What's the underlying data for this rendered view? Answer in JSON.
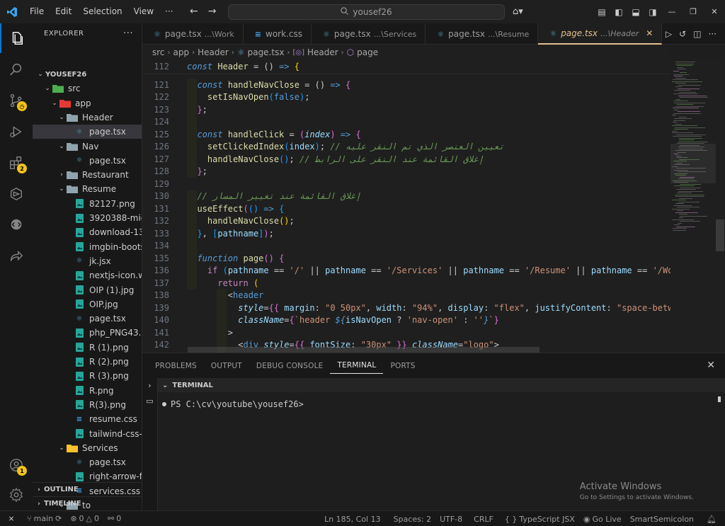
{
  "titlebar": {
    "menu": [
      "File",
      "Edit",
      "Selection",
      "View",
      "···"
    ],
    "search_text": "yousef26"
  },
  "activity_badges": {
    "extensions": "2",
    "accounts": "1"
  },
  "sidebar": {
    "title": "EXPLORER",
    "more": "···",
    "tree": [
      {
        "label": "YOUSEF26",
        "depth": 0,
        "kind": "root",
        "chev": "⌄"
      },
      {
        "label": "src",
        "depth": 1,
        "kind": "folder-src",
        "chev": "⌄"
      },
      {
        "label": "app",
        "depth": 2,
        "kind": "folder-app",
        "chev": "⌄"
      },
      {
        "label": "Header",
        "depth": 3,
        "kind": "folder",
        "chev": "⌄"
      },
      {
        "label": "page.tsx",
        "depth": 4,
        "kind": "tsx",
        "selected": true
      },
      {
        "label": "Nav",
        "depth": 3,
        "kind": "folder",
        "chev": "⌄"
      },
      {
        "label": "page.tsx",
        "depth": 4,
        "kind": "tsx"
      },
      {
        "label": "Restaurant",
        "depth": 3,
        "kind": "folder",
        "chev": "›"
      },
      {
        "label": "Resume",
        "depth": 3,
        "kind": "folder",
        "chev": "⌄"
      },
      {
        "label": "82127.png",
        "depth": 4,
        "kind": "img"
      },
      {
        "label": "3920388-mid...",
        "depth": 4,
        "kind": "img"
      },
      {
        "label": "download-13....",
        "depth": 4,
        "kind": "img"
      },
      {
        "label": "imgbin-boots...",
        "depth": 4,
        "kind": "img"
      },
      {
        "label": "jk.jsx",
        "depth": 4,
        "kind": "tsx"
      },
      {
        "label": "nextjs-icon.w...",
        "depth": 4,
        "kind": "img"
      },
      {
        "label": "OIP (1).jpg",
        "depth": 4,
        "kind": "img"
      },
      {
        "label": "OIP.jpg",
        "depth": 4,
        "kind": "img"
      },
      {
        "label": "page.tsx",
        "depth": 4,
        "kind": "tsx"
      },
      {
        "label": "php_PNG43.p...",
        "depth": 4,
        "kind": "img"
      },
      {
        "label": "R (1).png",
        "depth": 4,
        "kind": "img"
      },
      {
        "label": "R (2).png",
        "depth": 4,
        "kind": "img"
      },
      {
        "label": "R (3).png",
        "depth": 4,
        "kind": "img"
      },
      {
        "label": "R.png",
        "depth": 4,
        "kind": "img"
      },
      {
        "label": "R(3).png",
        "depth": 4,
        "kind": "img"
      },
      {
        "label": "resume.css",
        "depth": 4,
        "kind": "css"
      },
      {
        "label": "tailwind-css-i...",
        "depth": 4,
        "kind": "img"
      },
      {
        "label": "Services",
        "depth": 3,
        "kind": "folder-yellow",
        "chev": "⌄"
      },
      {
        "label": "page.tsx",
        "depth": 4,
        "kind": "tsx"
      },
      {
        "label": "right-arrow-fr...",
        "depth": 4,
        "kind": "img"
      },
      {
        "label": "services.css",
        "depth": 4,
        "kind": "css"
      },
      {
        "label": "to",
        "depth": 3,
        "kind": "folder",
        "chev": "⌄"
      }
    ],
    "outline": "OUTLINE",
    "timeline": "TIMELINE"
  },
  "tabs": [
    {
      "name": "page.tsx",
      "desc": "...\\Work",
      "icon": "tsx",
      "active": false
    },
    {
      "name": "work.css",
      "desc": "",
      "icon": "css",
      "active": false
    },
    {
      "name": "page.tsx",
      "desc": "...\\Services",
      "icon": "tsx",
      "active": false
    },
    {
      "name": "page.tsx",
      "desc": "...\\Resume",
      "icon": "tsx",
      "active": false
    },
    {
      "name": "page.tsx",
      "desc": "...\\Header",
      "icon": "tsx",
      "active": true
    }
  ],
  "tab_close": "✕",
  "breadcrumb": [
    "src",
    "app",
    "Header",
    "page.tsx",
    "Header",
    "page"
  ],
  "editor": {
    "line_numbers": [
      "112",
      "121",
      "122",
      "123",
      "124",
      "125",
      "126",
      "127",
      "128",
      "129",
      "130",
      "131",
      "132",
      "133",
      "134",
      "135",
      "136",
      "137",
      "138",
      "139",
      "140",
      "141",
      "142"
    ],
    "lines": [
      [
        [
          "kw",
          "const "
        ],
        [
          "fn",
          "Header"
        ],
        [
          "pun",
          " = () "
        ],
        [
          "kw",
          "=> "
        ],
        [
          "br1",
          "{"
        ]
      ],
      [
        [
          "pun",
          "  "
        ],
        [
          "kw",
          "const "
        ],
        [
          "fn",
          "handleNavClose"
        ],
        [
          "pun",
          " = () "
        ],
        [
          "kw",
          "=> "
        ],
        [
          "br2",
          "{"
        ]
      ],
      [
        [
          "pun",
          "    "
        ],
        [
          "fn",
          "setIsNavOpen"
        ],
        [
          "br3",
          "("
        ],
        [
          "bool",
          "false"
        ],
        [
          "br3",
          ")"
        ],
        [
          "pun",
          ";"
        ]
      ],
      [
        [
          "pun",
          "  "
        ],
        [
          "br2",
          "}"
        ],
        [
          "pun",
          ";"
        ]
      ],
      [
        [
          "pun",
          ""
        ]
      ],
      [
        [
          "pun",
          "  "
        ],
        [
          "kw",
          "const "
        ],
        [
          "fn",
          "handleClick"
        ],
        [
          "pun",
          " = "
        ],
        [
          "br2",
          "("
        ],
        [
          "prm",
          "index"
        ],
        [
          "br2",
          ")"
        ],
        [
          "pun",
          " "
        ],
        [
          "kw",
          "=> "
        ],
        [
          "br2",
          "{"
        ]
      ],
      [
        [
          "pun",
          "    "
        ],
        [
          "fn",
          "setClickedIndex"
        ],
        [
          "br3",
          "("
        ],
        [
          "var",
          "index"
        ],
        [
          "br3",
          ")"
        ],
        [
          "pun",
          "; "
        ],
        [
          "cmt",
          "// تعيين العنصر الذي تم النقر عليه"
        ]
      ],
      [
        [
          "pun",
          "    "
        ],
        [
          "fn",
          "handleNavClose"
        ],
        [
          "br3",
          "()"
        ],
        [
          "pun",
          "; "
        ],
        [
          "cmt",
          "// إغلاق القائمة عند النقر على الرابط"
        ]
      ],
      [
        [
          "pun",
          "  "
        ],
        [
          "br2",
          "}"
        ],
        [
          "pun",
          ";"
        ]
      ],
      [
        [
          "pun",
          ""
        ]
      ],
      [
        [
          "pun",
          "  "
        ],
        [
          "cmt",
          "// إغلاق القائمة عند تغيير المسار"
        ]
      ],
      [
        [
          "pun",
          "  "
        ],
        [
          "fn",
          "useEffect"
        ],
        [
          "br2",
          "("
        ],
        [
          "br3",
          "()"
        ],
        [
          "pun",
          " "
        ],
        [
          "kw",
          "=> "
        ],
        [
          "br3",
          "{"
        ]
      ],
      [
        [
          "pun",
          "    "
        ],
        [
          "fn",
          "handleNavClose"
        ],
        [
          "br1",
          "()"
        ],
        [
          "pun",
          ";"
        ]
      ],
      [
        [
          "pun",
          "  "
        ],
        [
          "br3",
          "}"
        ],
        [
          "pun",
          ", "
        ],
        [
          "br3",
          "["
        ],
        [
          "var",
          "pathname"
        ],
        [
          "br3",
          "]"
        ],
        [
          "br2",
          ")"
        ],
        [
          "pun",
          ";"
        ]
      ],
      [
        [
          "pun",
          ""
        ]
      ],
      [
        [
          "pun",
          "  "
        ],
        [
          "kw",
          "function "
        ],
        [
          "fn",
          "page"
        ],
        [
          "br2",
          "()"
        ],
        [
          "pun",
          " "
        ],
        [
          "br2",
          "{"
        ]
      ],
      [
        [
          "pun",
          "    "
        ],
        [
          "kw2",
          "if "
        ],
        [
          "br3",
          "("
        ],
        [
          "var",
          "pathname"
        ],
        [
          "pun",
          " == "
        ],
        [
          "str",
          "'/'"
        ],
        [
          "pun",
          " || "
        ],
        [
          "var",
          "pathname"
        ],
        [
          "pun",
          " == "
        ],
        [
          "str",
          "'/Services'"
        ],
        [
          "pun",
          " || "
        ],
        [
          "var",
          "pathname"
        ],
        [
          "pun",
          " == "
        ],
        [
          "str",
          "'/Resume'"
        ],
        [
          "pun",
          " || "
        ],
        [
          "var",
          "pathname"
        ],
        [
          "pun",
          " == "
        ],
        [
          "str",
          "'/Wor"
        ]
      ],
      [
        [
          "pun",
          "      "
        ],
        [
          "kw2",
          "return "
        ],
        [
          "br1",
          "("
        ]
      ],
      [
        [
          "pun",
          "        "
        ],
        [
          "pun",
          "<"
        ],
        [
          "tag",
          "header"
        ]
      ],
      [
        [
          "pun",
          "          "
        ],
        [
          "attr",
          "style"
        ],
        [
          "pun",
          "="
        ],
        [
          "br2",
          "{{"
        ],
        [
          "pun",
          " "
        ],
        [
          "var",
          "margin"
        ],
        [
          "pun",
          ": "
        ],
        [
          "str",
          "\"0 50px\""
        ],
        [
          "pun",
          ", "
        ],
        [
          "var",
          "width"
        ],
        [
          "pun",
          ": "
        ],
        [
          "str",
          "\"94%\""
        ],
        [
          "pun",
          ", "
        ],
        [
          "var",
          "display"
        ],
        [
          "pun",
          ": "
        ],
        [
          "str",
          "\"flex\""
        ],
        [
          "pun",
          ", "
        ],
        [
          "var",
          "justifyContent"
        ],
        [
          "pun",
          ": "
        ],
        [
          "str",
          "\"space-betwe"
        ]
      ],
      [
        [
          "pun",
          "          "
        ],
        [
          "attr",
          "className"
        ],
        [
          "pun",
          "="
        ],
        [
          "br2",
          "{"
        ],
        [
          "str",
          "`header "
        ],
        [
          "kw",
          "${"
        ],
        [
          "var",
          "isNavOpen"
        ],
        [
          "pun",
          " ? "
        ],
        [
          "str",
          "'nav-open'"
        ],
        [
          "pun",
          " : "
        ],
        [
          "str",
          "''"
        ],
        [
          "kw",
          "}"
        ],
        [
          "str",
          "`"
        ],
        [
          "br2",
          "}"
        ]
      ],
      [
        [
          "pun",
          "        "
        ],
        [
          "pun",
          ">"
        ]
      ],
      [
        [
          "pun",
          "          "
        ],
        [
          "pun",
          "<"
        ],
        [
          "tag",
          "div "
        ],
        [
          "attr",
          "style"
        ],
        [
          "pun",
          "="
        ],
        [
          "br2",
          "{{"
        ],
        [
          "pun",
          " "
        ],
        [
          "var",
          "fontSize"
        ],
        [
          "pun",
          ": "
        ],
        [
          "str",
          "\"30px\""
        ],
        [
          "pun",
          " "
        ],
        [
          "br2",
          "}}"
        ],
        [
          "pun",
          " "
        ],
        [
          "attr",
          "className"
        ],
        [
          "pun",
          "="
        ],
        [
          "str",
          "\"logo\""
        ],
        [
          "pun",
          ">"
        ]
      ]
    ]
  },
  "panel": {
    "tabs": [
      "PROBLEMS",
      "OUTPUT",
      "DEBUG CONSOLE",
      "TERMINAL",
      "PORTS"
    ],
    "active_tab": "TERMINAL",
    "terminal_title": "TERMINAL",
    "prompt": "PS C:\\cv\\youtube\\yousef26>",
    "activate_title": "Activate Windows",
    "activate_sub": "Go to Settings to activate Windows."
  },
  "statusbar": {
    "branch": "main",
    "errors": "0",
    "warnings": "0",
    "ports": "0",
    "position": "Ln 185, Col 13",
    "spaces": "Spaces: 2",
    "encoding": "UTF-8",
    "eol": "CRLF",
    "language": "TypeScript JSX",
    "golive": "Go Live",
    "extension": "SmartSemicolon"
  }
}
